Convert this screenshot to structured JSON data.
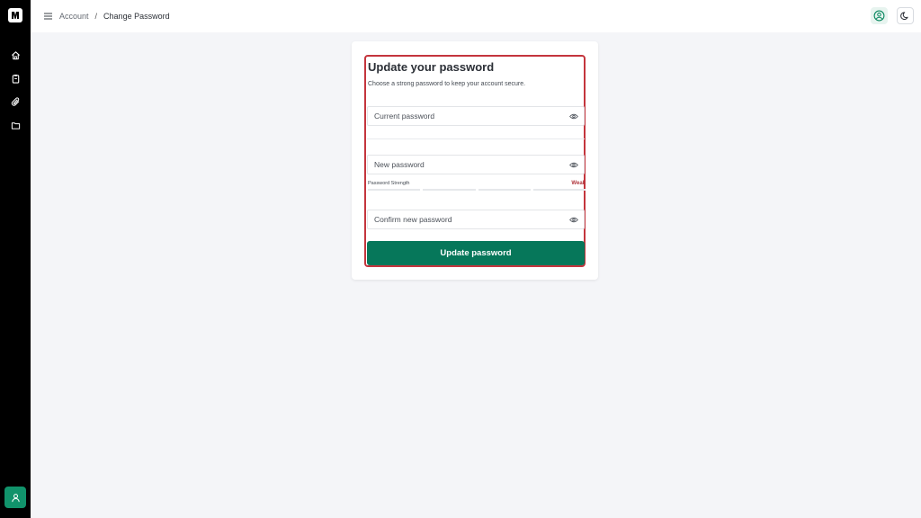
{
  "breadcrumb": {
    "parent": "Account",
    "separator": "/",
    "current": "Change Password"
  },
  "sidebar": {
    "items": [
      {
        "icon": "home-icon"
      },
      {
        "icon": "clipboard-icon"
      },
      {
        "icon": "paperclip-icon"
      },
      {
        "icon": "folder-icon"
      }
    ]
  },
  "form": {
    "title": "Update your password",
    "subtitle": "Choose a strong password to keep your account secure.",
    "current_password": {
      "placeholder": "Current password",
      "value": ""
    },
    "new_password": {
      "placeholder": "New password",
      "value": ""
    },
    "strength": {
      "label": "Password Strength",
      "value": "Weak",
      "filled_segments": 0,
      "total_segments": 4
    },
    "confirm_password": {
      "placeholder": "Confirm new password",
      "value": ""
    },
    "submit_label": "Update password"
  },
  "colors": {
    "primary": "#06775a",
    "sidebar_bg": "#000000",
    "highlight_border": "#c4353d",
    "weak": "#b0363d",
    "page_bg": "#f4f5f8"
  }
}
